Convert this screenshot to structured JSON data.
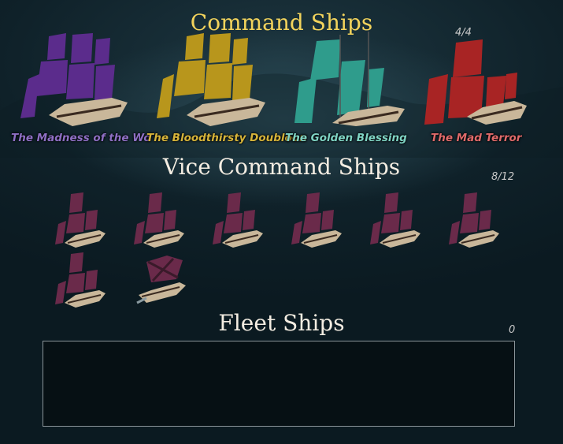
{
  "sections": {
    "command": {
      "title": "Command Ships",
      "count": "4/4"
    },
    "vice": {
      "title": "Vice Command Ships",
      "count": "8/12"
    },
    "fleet": {
      "title": "Fleet Ships",
      "count": "0"
    }
  },
  "command_ships": [
    {
      "name": "The Madness of the Wo",
      "sail_color": "#5b2c8c",
      "name_color": "#8e6fc4"
    },
    {
      "name": "The Bloodthirsty Doubloon",
      "sail_color": "#b8961c",
      "name_color": "#d6b43a"
    },
    {
      "name": "The Golden Blessing",
      "sail_color": "#2f9c8c",
      "name_color": "#7fd4c4"
    },
    {
      "name": "The Mad Terror",
      "sail_color": "#a82424",
      "name_color": "#e06a6a"
    }
  ],
  "vice_ship_icon": "ship-icon",
  "colors": {
    "command_title": "#f2d35c",
    "vice_sail": "#6a2a4a",
    "hull": "#c9b79a"
  }
}
